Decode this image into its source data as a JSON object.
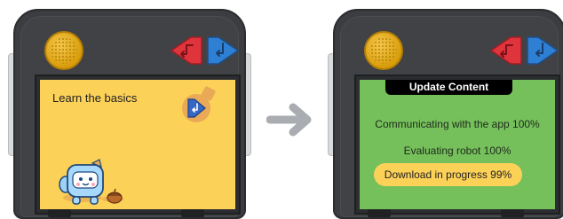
{
  "left_device": {
    "screen_text": "Learn the basics",
    "robot_icon": "robot-mascot-icon",
    "acorn_icon": "acorn-icon",
    "confirm_icon": "enter-icon"
  },
  "arrow_icon": "arrow-right-icon",
  "right_device": {
    "header": "Update Content",
    "line_app": "Communicating with the app 100%",
    "line_robot": "Evaluating robot 100%",
    "download": "Download in progress 99%",
    "download_progress": 99
  },
  "colors": {
    "case": "#3b3d40",
    "speaker": "#e0a814",
    "red_button": "#e0343c",
    "blue_button": "#2f7fd2",
    "screen_yellow": "#fcd158",
    "screen_green": "#76c05c",
    "arrow": "#a9adb1"
  }
}
